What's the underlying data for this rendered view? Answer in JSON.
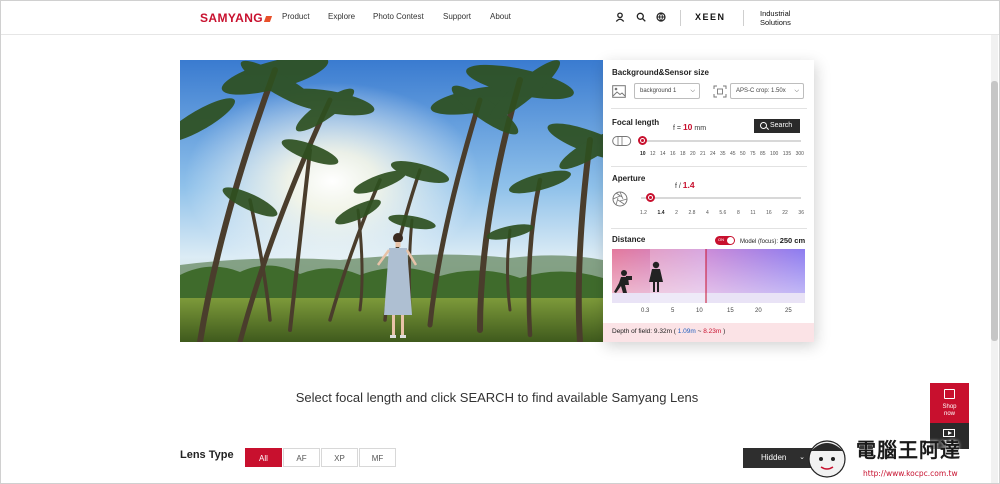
{
  "header": {
    "logo": "SAMYANG",
    "nav": [
      "Product",
      "Explore",
      "Photo Contest",
      "Support",
      "About"
    ],
    "icons": [
      "user-icon",
      "search-icon",
      "globe-icon"
    ],
    "xeen": "XEEN",
    "industrial_line1": "Industrial",
    "industrial_line2": "Solutions"
  },
  "panel": {
    "background_sensor": {
      "title": "Background&Sensor size",
      "background_select": "background 1",
      "sensor_select": "APS-C crop: 1.50x"
    },
    "focal_length": {
      "title": "Focal length",
      "prefix": "f =",
      "value": "10",
      "unit": "mm",
      "search_label": "Search",
      "ticks": [
        "10",
        "12",
        "14",
        "16",
        "18",
        "20",
        "21",
        "24",
        "35",
        "45",
        "50",
        "75",
        "85",
        "100",
        "135",
        "300"
      ]
    },
    "aperture": {
      "title": "Aperture",
      "prefix": "f /",
      "value": "1.4",
      "ticks": [
        "1.2",
        "1.4",
        "2",
        "2.8",
        "4",
        "5.6",
        "8",
        "11",
        "16",
        "22",
        "36"
      ]
    },
    "distance": {
      "title": "Distance",
      "toggle_label": "ON",
      "model_label": "Model (focus):",
      "model_value": "250 cm",
      "ticks": [
        "0.3",
        "5",
        "10",
        "15",
        "20",
        "25"
      ],
      "near_fraction": 0.2,
      "focus_fraction": 0.48
    },
    "dof": {
      "label": "Depth of field: 9.32m (",
      "near": "1.09m",
      "sep": "~",
      "far": "8.23m",
      "close": ")"
    }
  },
  "hint": "Select focal length and click SEARCH to find available Samyang Lens",
  "lens_type": {
    "label": "Lens Type",
    "tabs": [
      "All",
      "AF",
      "XP",
      "MF"
    ],
    "active": "All",
    "hidden_label": "Hidden"
  },
  "floating": {
    "shop_line1": "Shop",
    "shop_line2": "now",
    "tube_label": "Tube"
  },
  "watermark": {
    "title": "電腦王阿達",
    "url": "http://www.kocpc.com.tw"
  },
  "colors": {
    "brand_red": "#c8102e",
    "dark": "#2a2a2a"
  }
}
